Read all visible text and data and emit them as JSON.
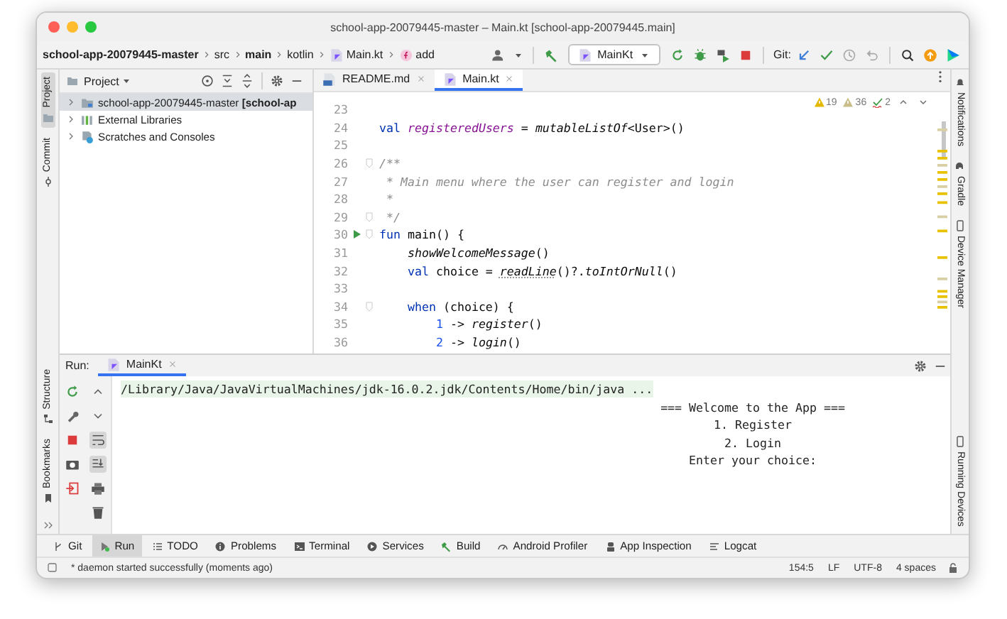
{
  "window": {
    "title": "school-app-20079445-master – Main.kt [school-app-20079445.main]"
  },
  "breadcrumbs": [
    {
      "label": "school-app-20079445-master",
      "bold": true
    },
    {
      "label": "src",
      "bold": false
    },
    {
      "label": "main",
      "bold": true
    },
    {
      "label": "kotlin",
      "bold": false
    },
    {
      "label": "Main.kt",
      "bold": false
    },
    {
      "label": "add",
      "bold": false
    }
  ],
  "toolbar": {
    "run_config": "MainKt",
    "git_label": "Git:"
  },
  "left_stripe": [
    {
      "label": "Project",
      "selected": true
    },
    {
      "label": "Commit",
      "selected": false
    }
  ],
  "left_stripe_bottom": [
    {
      "label": "Structure",
      "selected": false
    },
    {
      "label": "Bookmarks",
      "selected": false
    }
  ],
  "right_stripe": [
    {
      "label": "Notifications"
    },
    {
      "label": "Gradle"
    },
    {
      "label": "Device Manager"
    }
  ],
  "right_stripe_bottom": [
    {
      "label": "Running Devices"
    }
  ],
  "project_panel": {
    "title": "Project",
    "tree": [
      {
        "label": "school-app-20079445-master **[school-ap**",
        "selected": true,
        "expanded": false
      },
      {
        "label": "External Libraries",
        "selected": false,
        "expanded": false
      },
      {
        "label": "Scratches and Consoles",
        "selected": false,
        "expanded": false
      }
    ]
  },
  "editor_tabs": [
    {
      "label": "README.md",
      "selected": false
    },
    {
      "label": "Main.kt",
      "selected": true
    }
  ],
  "inspections": [
    "19",
    "36",
    "2"
  ],
  "code_lines": [
    {
      "number": "23"
    },
    {
      "number": "24",
      "tokens": [
        {
          "text": "val",
          "kind": "kw"
        },
        {
          "text": " registeredUsers",
          "kind": "prop"
        },
        {
          "text": " = ",
          "kind": "plain"
        },
        {
          "text": "mutableListOf",
          "kind": "fn"
        },
        {
          "text": "<User>()",
          "kind": "plain"
        }
      ]
    },
    {
      "number": "25"
    },
    {
      "number": "26",
      "fold": true,
      "tokens": [
        {
          "text": "/**",
          "kind": "comment"
        }
      ]
    },
    {
      "number": "27",
      "tokens": [
        {
          "text": " * Main menu where the user can register and login",
          "kind": "comment"
        }
      ]
    },
    {
      "number": "28",
      "tokens": [
        {
          "text": " *",
          "kind": "comment"
        }
      ]
    },
    {
      "number": "29",
      "fold": true,
      "tokens": [
        {
          "text": " */",
          "kind": "comment"
        }
      ]
    },
    {
      "number": "30",
      "run": true,
      "fold": true,
      "tokens": [
        {
          "text": "fun",
          "kind": "kw"
        },
        {
          "text": " main() {",
          "kind": "plain"
        }
      ]
    },
    {
      "number": "31",
      "tokens": [
        {
          "text": "    showWelcomeMessage",
          "kind": "fn"
        },
        {
          "text": "()",
          "kind": "plain"
        }
      ]
    },
    {
      "number": "32",
      "tokens": [
        {
          "text": "    val",
          "kind": "kw"
        },
        {
          "text": " choice = ",
          "kind": "plain"
        },
        {
          "text": "readLine",
          "kind": "warn"
        },
        {
          "text": "()?.",
          "kind": "plain"
        },
        {
          "text": "toIntOrNull",
          "kind": "fn"
        },
        {
          "text": "()",
          "kind": "plain"
        }
      ]
    },
    {
      "number": "33"
    },
    {
      "number": "34",
      "fold": true,
      "tokens": [
        {
          "text": "    when",
          "kind": "kw"
        },
        {
          "text": " (choice) {",
          "kind": "plain"
        }
      ]
    },
    {
      "number": "35",
      "tokens": [
        {
          "text": "        1",
          "kind": "num"
        },
        {
          "text": " -> ",
          "kind": "plain"
        },
        {
          "text": "register",
          "kind": "fn"
        },
        {
          "text": "()",
          "kind": "plain"
        }
      ]
    },
    {
      "number": "36",
      "tokens": [
        {
          "text": "        2",
          "kind": "num"
        },
        {
          "text": " -> ",
          "kind": "plain"
        },
        {
          "text": "login",
          "kind": "fn"
        },
        {
          "text": "()",
          "kind": "plain"
        }
      ]
    }
  ],
  "run_panel": {
    "label": "Run:",
    "tab": "MainKt",
    "command": "/Library/Java/JavaVirtualMachines/jdk-16.0.2.jdk/Contents/Home/bin/java ...",
    "output": [
      "=== Welcome to the App ===",
      "1. Register",
      "2. Login",
      "Enter your choice:"
    ]
  },
  "tool_windows": [
    {
      "label": "Git",
      "selected": false
    },
    {
      "label": "Run",
      "selected": true
    },
    {
      "label": "TODO",
      "selected": false
    },
    {
      "label": "Problems",
      "selected": false
    },
    {
      "label": "Terminal",
      "selected": false
    },
    {
      "label": "Services",
      "selected": false
    },
    {
      "label": "Build",
      "selected": false
    },
    {
      "label": "Android Profiler",
      "selected": false
    },
    {
      "label": "App Inspection",
      "selected": false
    },
    {
      "label": "Logcat",
      "selected": false
    }
  ],
  "status_bar": {
    "message": "* daemon started successfully (moments ago)",
    "items": [
      "154:5",
      "LF",
      "UTF-8",
      "4 spaces"
    ]
  }
}
